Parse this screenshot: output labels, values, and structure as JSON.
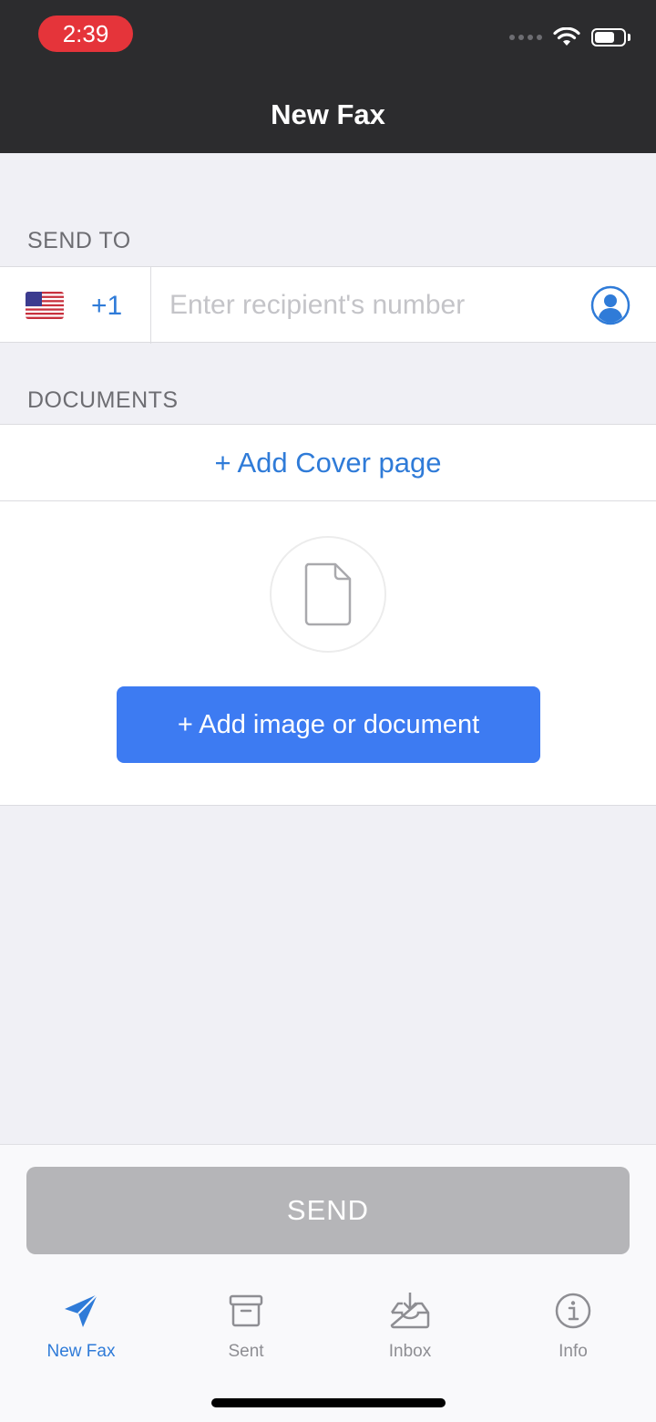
{
  "status_bar": {
    "time": "2:39"
  },
  "header": {
    "title": "New Fax"
  },
  "send_to": {
    "label": "SEND TO",
    "country_code": "+1",
    "country_flag": "us-flag-icon",
    "recipient_placeholder": "Enter recipient's number",
    "recipient_value": ""
  },
  "documents": {
    "label": "DOCUMENTS",
    "add_cover_label": "+ Add Cover page",
    "add_document_label": "+ Add image or document"
  },
  "send_button": {
    "label": "SEND"
  },
  "tabs": [
    {
      "label": "New Fax",
      "icon": "paper-plane-icon",
      "active": true
    },
    {
      "label": "Sent",
      "icon": "archive-box-icon",
      "active": false
    },
    {
      "label": "Inbox",
      "icon": "inbox-tray-icon",
      "active": false
    },
    {
      "label": "Info",
      "icon": "info-circle-icon",
      "active": false
    }
  ],
  "colors": {
    "accent": "#2f7bd8",
    "primary_button": "#3d7bf2",
    "disabled_button": "#b5b5b8",
    "header_bg": "#2c2c2e",
    "time_pill": "#e5343a"
  }
}
